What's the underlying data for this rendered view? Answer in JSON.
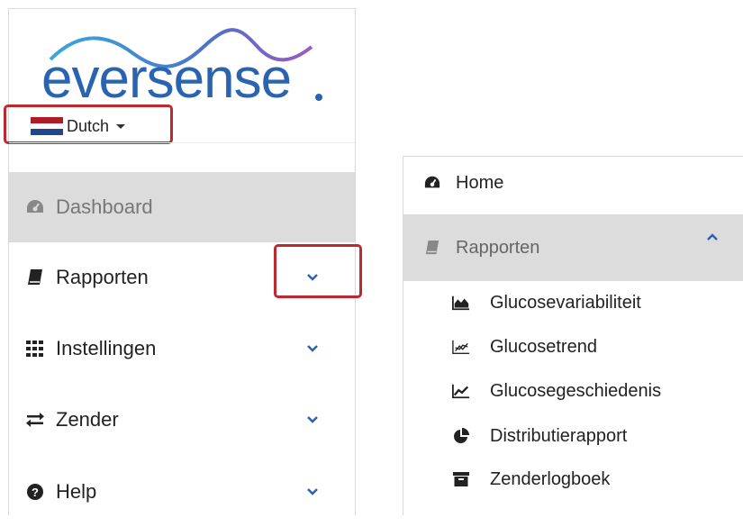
{
  "brand": {
    "logo_text": "eversense"
  },
  "language": {
    "label": "Dutch",
    "flag_colors": [
      "#ae1c28",
      "#ffffff",
      "#21468b"
    ]
  },
  "left_nav": {
    "items": [
      {
        "label": "Dashboard",
        "icon": "dashboard-icon",
        "active": true
      },
      {
        "label": "Rapporten",
        "icon": "book-icon"
      },
      {
        "label": "Instellingen",
        "icon": "grid-icon"
      },
      {
        "label": "Zender",
        "icon": "exchange-icon"
      },
      {
        "label": "Help",
        "icon": "question-circle-icon"
      }
    ]
  },
  "right_nav": {
    "home": {
      "label": "Home",
      "icon": "dashboard-icon"
    },
    "reports": {
      "label": "Rapporten",
      "icon": "book-icon",
      "expanded": true
    },
    "sub_items": [
      {
        "label": "Glucosevariabiliteit",
        "icon": "area-chart-icon"
      },
      {
        "label": "Glucosetrend",
        "icon": "trend-chart-icon"
      },
      {
        "label": "Glucosegeschiedenis",
        "icon": "line-chart-icon"
      },
      {
        "label": "Distributierapport",
        "icon": "pie-chart-icon"
      },
      {
        "label": "Zenderlogboek",
        "icon": "archive-icon"
      }
    ]
  },
  "colors": {
    "accent": "#2a63b0",
    "highlight_box": "#c0282f",
    "active_bg": "#dcdcdc"
  }
}
